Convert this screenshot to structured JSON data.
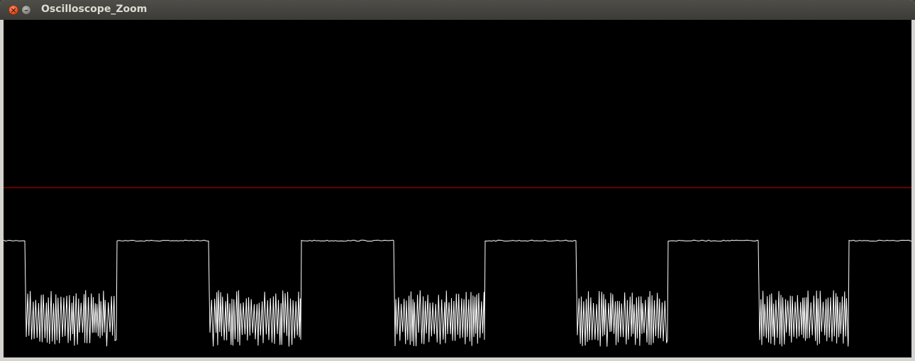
{
  "window": {
    "title": "Oscilloscope_Zoom",
    "close_icon": "×",
    "minimize_icon": "–"
  },
  "plot": {
    "background": "#000000",
    "reference_line_color": "#cc0000",
    "trace_color": "#ffffff",
    "segments": [
      {
        "from": 0,
        "to": 30,
        "state": "high"
      },
      {
        "from": 30,
        "to": 160,
        "state": "noise"
      },
      {
        "from": 160,
        "to": 289,
        "state": "high"
      },
      {
        "from": 289,
        "to": 420,
        "state": "noise"
      },
      {
        "from": 420,
        "to": 550,
        "state": "high"
      },
      {
        "from": 550,
        "to": 679,
        "state": "noise"
      },
      {
        "from": 679,
        "to": 807,
        "state": "high"
      },
      {
        "from": 807,
        "to": 937,
        "state": "noise"
      },
      {
        "from": 937,
        "to": 1064,
        "state": "high"
      },
      {
        "from": 1064,
        "to": 1192,
        "state": "noise"
      },
      {
        "from": 1192,
        "to": 1280,
        "state": "high"
      }
    ]
  }
}
